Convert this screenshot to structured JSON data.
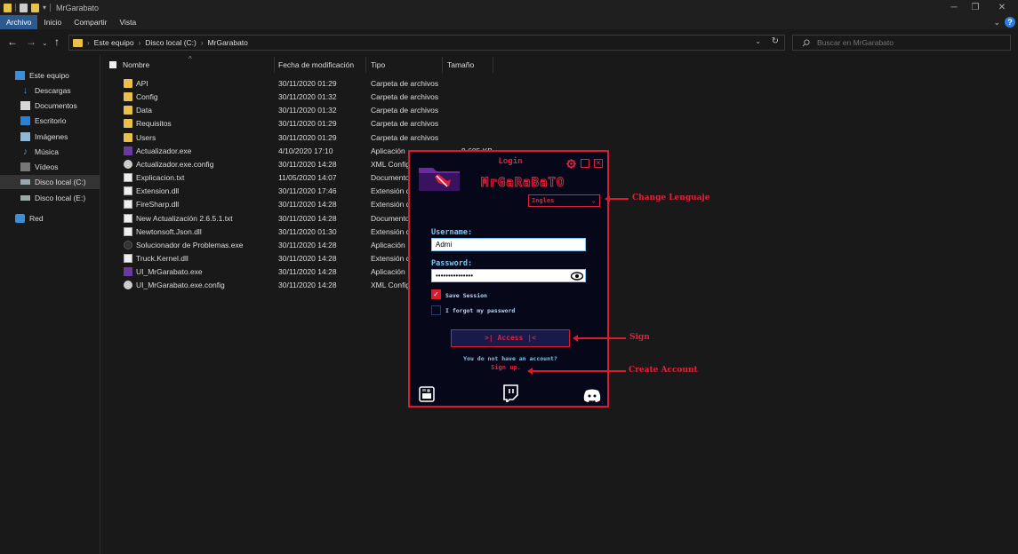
{
  "window": {
    "title": "MrGarabato"
  },
  "ribbon": {
    "tabs": [
      "Archivo",
      "Inicio",
      "Compartir",
      "Vista"
    ]
  },
  "address": {
    "crumbs": [
      "Este equipo",
      "Disco local (C:)",
      "MrGarabato"
    ],
    "search_placeholder": "Buscar en MrGarabato"
  },
  "sidebar": {
    "items": [
      {
        "label": "Este equipo",
        "icon": "computer-icon"
      },
      {
        "label": "Descargas",
        "icon": "download-icon"
      },
      {
        "label": "Documentos",
        "icon": "document-icon"
      },
      {
        "label": "Escritorio",
        "icon": "desktop-icon"
      },
      {
        "label": "Imágenes",
        "icon": "image-icon"
      },
      {
        "label": "Música",
        "icon": "music-icon"
      },
      {
        "label": "Vídeos",
        "icon": "video-icon"
      },
      {
        "label": "Disco local (C:)",
        "icon": "drive-icon"
      },
      {
        "label": "Disco local (E:)",
        "icon": "drive-icon"
      },
      {
        "label": "Red",
        "icon": "network-icon"
      }
    ]
  },
  "columns": {
    "name": "Nombre",
    "date": "Fecha de modificación",
    "type": "Tipo",
    "size": "Tamaño"
  },
  "files": [
    {
      "name": "API",
      "date": "30/11/2020 01:29",
      "type": "Carpeta de archivos",
      "size": "",
      "icon": "folder"
    },
    {
      "name": "Config",
      "date": "30/11/2020 01:32",
      "type": "Carpeta de archivos",
      "size": "",
      "icon": "folder"
    },
    {
      "name": "Data",
      "date": "30/11/2020 01:32",
      "type": "Carpeta de archivos",
      "size": "",
      "icon": "folder"
    },
    {
      "name": "Requisitos",
      "date": "30/11/2020 01:29",
      "type": "Carpeta de archivos",
      "size": "",
      "icon": "folder"
    },
    {
      "name": "Users",
      "date": "30/11/2020 01:29",
      "type": "Carpeta de archivos",
      "size": "",
      "icon": "folder"
    },
    {
      "name": "Actualizador.exe",
      "date": "4/10/2020 17:10",
      "type": "Aplicación",
      "size": "9.605 KB",
      "icon": "exe"
    },
    {
      "name": "Actualizador.exe.config",
      "date": "30/11/2020 14:28",
      "type": "XML Config",
      "size": "",
      "icon": "cfg"
    },
    {
      "name": "Explicacion.txt",
      "date": "11/05/2020 14:07",
      "type": "Documento",
      "size": "",
      "icon": "doc"
    },
    {
      "name": "Extension.dll",
      "date": "30/11/2020 17:46",
      "type": "Extensión d",
      "size": "",
      "icon": "doc"
    },
    {
      "name": "FireSharp.dll",
      "date": "30/11/2020 14:28",
      "type": "Extensión d",
      "size": "",
      "icon": "doc"
    },
    {
      "name": "New Actualización 2.6.5.1.txt",
      "date": "30/11/2020 14:28",
      "type": "Documento",
      "size": "",
      "icon": "doc"
    },
    {
      "name": "Newtonsoft.Json.dll",
      "date": "30/11/2020 01:30",
      "type": "Extensión d",
      "size": "",
      "icon": "doc"
    },
    {
      "name": "Solucionador de Problemas.exe",
      "date": "30/11/2020 14:28",
      "type": "Aplicación",
      "size": "",
      "icon": "dark"
    },
    {
      "name": "Truck.Kernel.dll",
      "date": "30/11/2020 14:28",
      "type": "Extensión d",
      "size": "",
      "icon": "doc"
    },
    {
      "name": "UI_MrGarabato.exe",
      "date": "30/11/2020 14:28",
      "type": "Aplicación",
      "size": "",
      "icon": "exe"
    },
    {
      "name": "UI_MrGarabato.exe.config",
      "date": "30/11/2020 14:28",
      "type": "XML Config",
      "size": "",
      "icon": "cfg"
    }
  ],
  "login": {
    "title": "Login",
    "brand": "MrGaRaBaTO",
    "language": "Ingles",
    "username_label": "Username:",
    "username_value": "Admi",
    "password_label": "Password:",
    "password_value": "•••••••••••••••",
    "save_session": "Save Session",
    "forgot_password": "I forgot my password",
    "access_button": ">| Access |<",
    "no_account": "You do not have an account?",
    "signup": "Sign up.",
    "accent": "#d81c2b"
  },
  "annotations": {
    "change_language": "Change Lenguaje",
    "sign": "Sign",
    "create_account": "Create Account"
  }
}
